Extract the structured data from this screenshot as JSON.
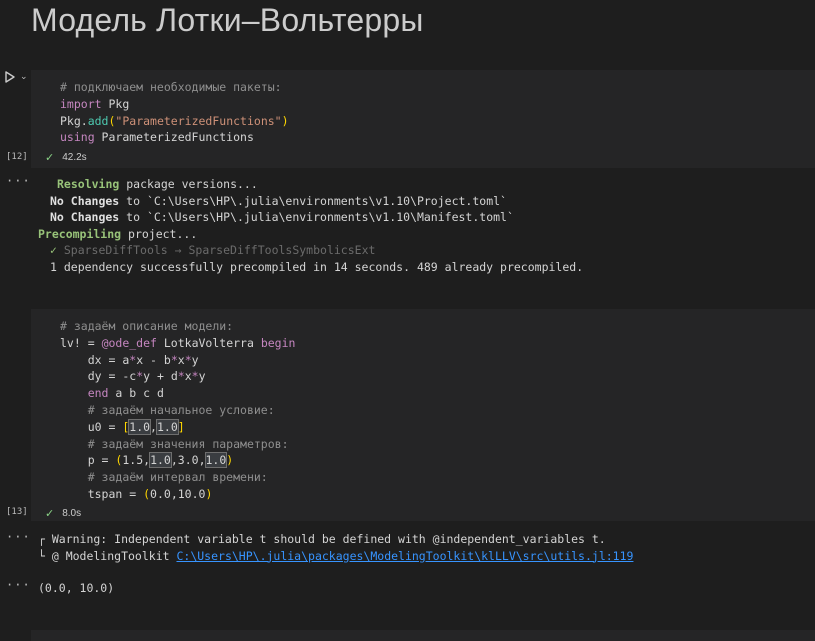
{
  "title": "Модель Лотки–Вольтерры",
  "cell1": {
    "exec_count": "[12]",
    "duration": "42.2s",
    "code": {
      "comment": "# подключаем необходимые пакеты:",
      "import_kw": "import",
      "import_mod": " Pkg",
      "pkg": "Pkg.",
      "add_fn": "add",
      "paren_open": "(",
      "str": "\"ParameterizedFunctions\"",
      "paren_close": ")",
      "using_kw": "using",
      "using_mod": " ParameterizedFunctions"
    },
    "output": {
      "l1_bold": "Resolving",
      "l1_rest": " package versions...",
      "l2_bold": "No Changes",
      "l2_rest": " to `C:\\Users\\HP\\.julia\\environments\\v1.10\\Project.toml`",
      "l3_bold": "No Changes",
      "l3_rest": " to `C:\\Users\\HP\\.julia\\environments\\v1.10\\Manifest.toml`",
      "l4_bold": "Precompiling",
      "l4_rest": " project...",
      "l5_check": "✓",
      "l5_dim": " SparseDiffTools → SparseDiffToolsSymbolicsExt",
      "l6": "1 dependency successfully precompiled in 14 seconds. 489 already precompiled."
    }
  },
  "cell2": {
    "exec_count": "[13]",
    "duration": "8.0s",
    "code": {
      "c1": "# задаём описание модели:",
      "lv_name": "lv!",
      "eq": " = ",
      "macro": "@ode_def",
      "model_name": " LotkaVolterra ",
      "begin_kw": "begin",
      "dx_lhs": "dx = a",
      "dx_rest1": "x - b",
      "dx_rest2": "x",
      "dx_end": "y",
      "dy_lhs": "dy = ",
      "dy_neg": "-c",
      "dy_rest": "y + d",
      "dy_x": "x",
      "dy_end": "y",
      "end_kw": "end",
      "end_rest": " a b c d",
      "c2": "# задаём начальное условие:",
      "u0_lhs": "u0 = ",
      "u0_a": "1.0",
      "u0_b": "1.0",
      "c3": "# задаём значения параметров:",
      "p_lhs": "p = ",
      "p_a": "1.5",
      "p_b": "1.0",
      "p_c": "3.0",
      "p_d": "1.0",
      "c4": "# задаём интервал времени:",
      "tspan_lhs": "tspan = ",
      "t_a": "0.0",
      "t_b": "10.0"
    },
    "output": {
      "warn1": "┌ Warning: Independent variable t should be defined with @independent_variables t.",
      "warn2_prefix": "└ @ ModelingToolkit ",
      "warn2_link": "C:\\Users\\HP\\.julia\\packages\\ModelingToolkit\\klLLV\\src\\utils.jl:119",
      "result": "(0.0, 10.0)"
    }
  }
}
